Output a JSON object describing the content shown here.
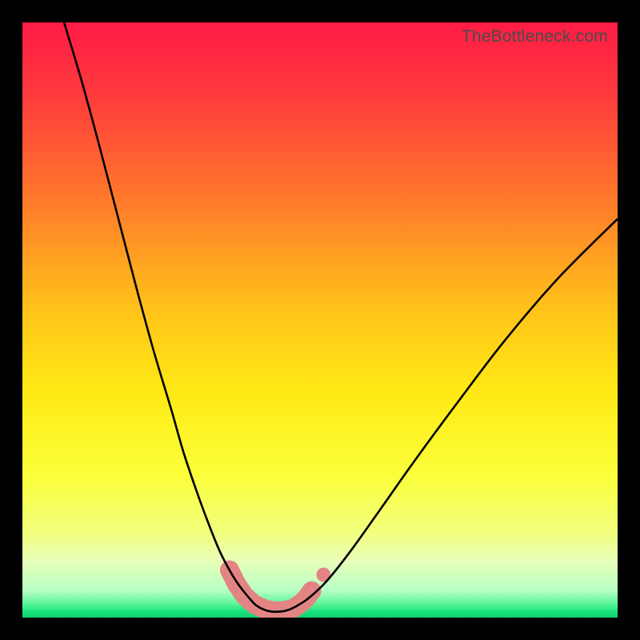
{
  "watermark": "TheBottleneck.com",
  "colors": {
    "frame_bg": "#000000",
    "curve_stroke": "#000000",
    "marker_fill": "#e38484",
    "marker_stroke": "#c96a6a",
    "gradient_stops": [
      {
        "offset": 0.0,
        "color": "#ff1b45"
      },
      {
        "offset": 0.12,
        "color": "#ff3a3d"
      },
      {
        "offset": 0.3,
        "color": "#ff7a2a"
      },
      {
        "offset": 0.48,
        "color": "#ffc21a"
      },
      {
        "offset": 0.62,
        "color": "#ffe914"
      },
      {
        "offset": 0.76,
        "color": "#fbff3a"
      },
      {
        "offset": 0.86,
        "color": "#f1ff80"
      },
      {
        "offset": 0.905,
        "color": "#e8ffb8"
      },
      {
        "offset": 0.955,
        "color": "#b6ffc4"
      },
      {
        "offset": 0.975,
        "color": "#63f79a"
      },
      {
        "offset": 0.99,
        "color": "#18e27c"
      },
      {
        "offset": 1.0,
        "color": "#0fcf70"
      }
    ]
  },
  "chart_data": {
    "type": "line",
    "title": "",
    "xlabel": "",
    "ylabel": "",
    "xlim": [
      0,
      100
    ],
    "ylim": [
      0,
      100
    ],
    "grid": false,
    "series": [
      {
        "name": "left-curve",
        "x": [
          7,
          10,
          13,
          16,
          19,
          22,
          25,
          27,
          29,
          31,
          33,
          34.5,
          36,
          37.5,
          39,
          40
        ],
        "y": [
          100,
          90,
          79,
          67.5,
          56,
          45,
          35,
          28,
          22,
          16.5,
          11.5,
          8.5,
          6,
          4,
          2.3,
          1.6
        ]
      },
      {
        "name": "valley-floor",
        "x": [
          40,
          41,
          42,
          43,
          44,
          45,
          46
        ],
        "y": [
          1.6,
          1.2,
          1.0,
          1.0,
          1.1,
          1.4,
          1.9
        ]
      },
      {
        "name": "right-curve",
        "x": [
          46,
          48,
          51,
          55,
          60,
          66,
          73,
          81,
          90,
          100
        ],
        "y": [
          1.9,
          3.2,
          6,
          11,
          18,
          26.5,
          36,
          46.5,
          57,
          67
        ]
      }
    ],
    "markers": {
      "comment": "Pink rounded segments overlaid near the curve minimum",
      "points": [
        {
          "x": 34.8,
          "y": 8.0
        },
        {
          "x": 36.0,
          "y": 5.6
        },
        {
          "x": 37.4,
          "y": 3.6
        },
        {
          "x": 39.0,
          "y": 2.2
        },
        {
          "x": 40.8,
          "y": 1.4
        },
        {
          "x": 42.6,
          "y": 1.1
        },
        {
          "x": 44.2,
          "y": 1.2
        },
        {
          "x": 45.6,
          "y": 1.6
        },
        {
          "x": 46.8,
          "y": 2.4
        },
        {
          "x": 47.8,
          "y": 3.4
        },
        {
          "x": 48.6,
          "y": 4.5
        },
        {
          "x": 50.6,
          "y": 7.2
        }
      ],
      "radius_data_units": 1.6
    }
  }
}
